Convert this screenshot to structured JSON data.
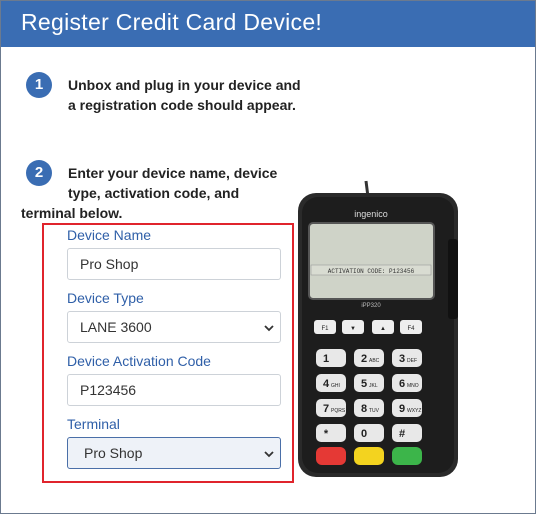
{
  "header": {
    "title": "Register Credit Card Device!"
  },
  "steps": [
    {
      "number": "1",
      "lines": [
        "Unbox and plug in your device and",
        "a registration code should appear."
      ]
    },
    {
      "number": "2",
      "lines": [
        "Enter your device name, device",
        "type, activation code, and",
        "terminal below."
      ]
    }
  ],
  "form": {
    "device_name": {
      "label": "Device Name",
      "value": "Pro Shop"
    },
    "device_type": {
      "label": "Device Type",
      "value": "LANE 3600"
    },
    "activation_code": {
      "label": "Device Activation Code",
      "value": "P123456"
    },
    "terminal": {
      "label": "Terminal",
      "value": "Pro Shop"
    }
  },
  "device_image": {
    "brand": "ingenico",
    "model": "iPP320",
    "screen_text": "ACTIVATION CODE: P123456",
    "fkeys": [
      "F1",
      "▼",
      "▲",
      "F4"
    ],
    "keys": [
      "1",
      "2",
      "3",
      "4",
      "5",
      "6",
      "7",
      "8",
      "9",
      "*",
      "0",
      "#"
    ],
    "key_subs": [
      "",
      "ABC",
      "DEF",
      "GHI",
      "JKL",
      "MNO",
      "PQRS",
      "TUV",
      "WXYZ",
      "",
      "",
      ""
    ]
  },
  "colors": {
    "header": "#3a6db3",
    "highlight_border": "#e0242c",
    "label": "#2f5fa8"
  }
}
